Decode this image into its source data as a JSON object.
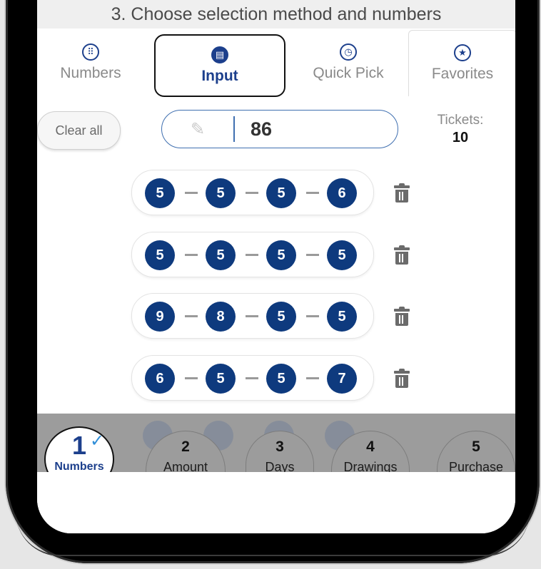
{
  "header": {
    "title": "3. Choose selection method and numbers"
  },
  "tabs": [
    {
      "label": "Numbers",
      "icon": "dots-grid-icon"
    },
    {
      "label": "Input",
      "icon": "clipboard-icon",
      "selected": true
    },
    {
      "label": "Quick Pick",
      "icon": "clock-icon"
    },
    {
      "label": "Favorites",
      "icon": "star-icon"
    }
  ],
  "controls": {
    "clear_label": "Clear all",
    "input_value": "86",
    "tickets_label": "Tickets:",
    "tickets_count": "10"
  },
  "rows": [
    {
      "balls": [
        "5",
        "5",
        "5",
        "6"
      ]
    },
    {
      "balls": [
        "5",
        "5",
        "5",
        "5"
      ]
    },
    {
      "balls": [
        "9",
        "8",
        "5",
        "5"
      ]
    },
    {
      "balls": [
        "6",
        "5",
        "5",
        "7"
      ]
    }
  ],
  "stepper": [
    {
      "num": "1",
      "label": "Numbers",
      "done": true
    },
    {
      "num": "2",
      "label": "Amount"
    },
    {
      "num": "3",
      "label": "Days"
    },
    {
      "num": "4",
      "label": "Drawings"
    },
    {
      "num": "5",
      "label": "Purchase"
    }
  ],
  "colors": {
    "brand_blue": "#0e3a7e",
    "accent_blue": "#1c3f8c",
    "check_blue": "#2f8ed8"
  }
}
